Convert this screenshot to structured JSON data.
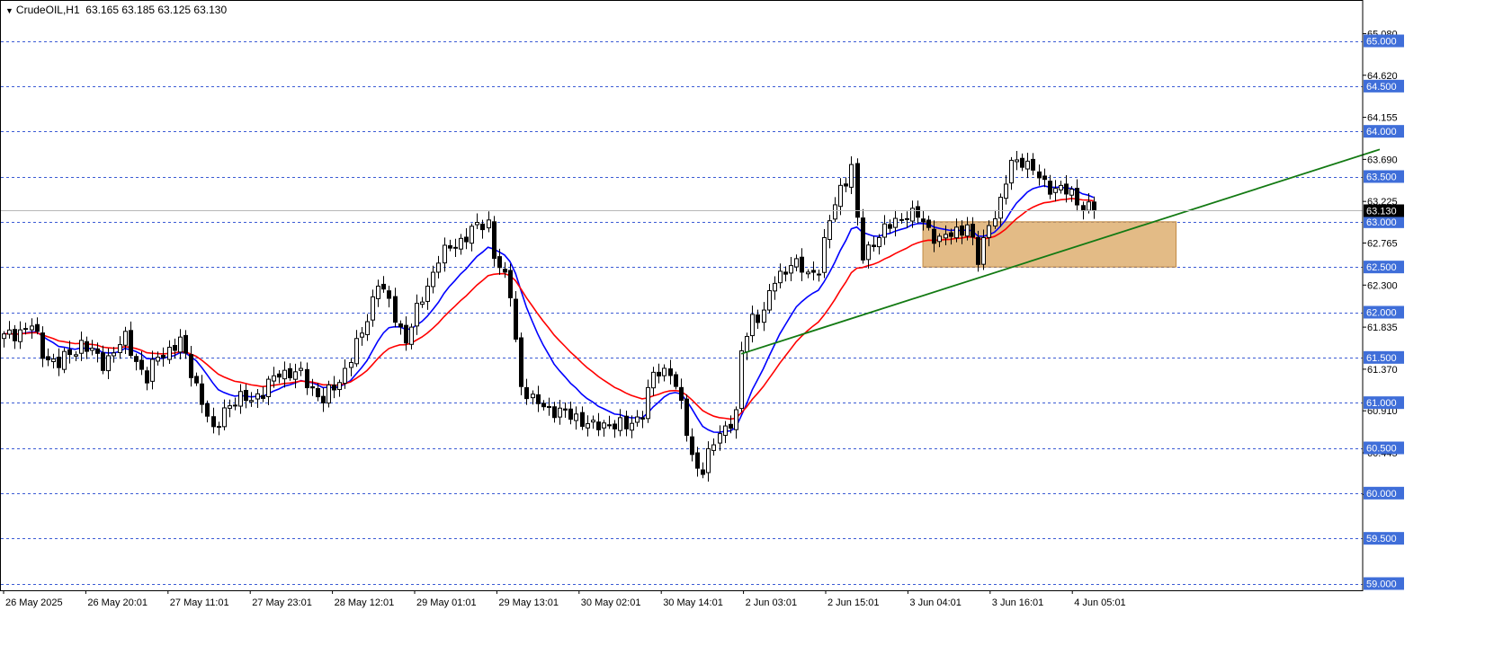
{
  "header": {
    "symbol": "CrudeOIL,H1",
    "ohlc": "63.165 63.185 63.125 63.130"
  },
  "colors": {
    "ema_fast": "#0000ff",
    "ema_slow": "#ff0000",
    "trendline": "#137a13",
    "zone": "#d9a45d",
    "level_line": "#3b5bd4",
    "level_label_bg": "#3f6ed9",
    "price_label_bg": "#000000"
  },
  "chart_data": {
    "type": "candlestick",
    "instrument": "CrudeOIL",
    "timeframe": "H1",
    "ylim": [
      58.85,
      65.5
    ],
    "current_price": 63.13,
    "axis_ticks": [
      "65.080",
      "64.620",
      "64.155",
      "63.690",
      "63.225",
      "62.765",
      "62.300",
      "61.835",
      "61.370",
      "60.910",
      "60.445",
      "59.985"
    ],
    "horizontal_levels": [
      "65.000",
      "64.500",
      "64.000",
      "63.500",
      "63.000",
      "62.500",
      "62.000",
      "61.500",
      "61.000",
      "60.500",
      "60.000",
      "59.500",
      "59.000"
    ],
    "x_labels": [
      "26 May 2025",
      "26 May 20:01",
      "27 May 11:01",
      "27 May 23:01",
      "28 May 12:01",
      "29 May 01:01",
      "29 May 13:01",
      "30 May 02:01",
      "30 May 14:01",
      "2 Jun 03:01",
      "2 Jun 15:01",
      "3 Jun 04:01",
      "3 Jun 16:01",
      "4 Jun 05:01"
    ],
    "zone": {
      "start_bar": 167,
      "end_bar": 213,
      "low": 62.5,
      "high": 63.0
    },
    "trendline": {
      "start_bar": 134,
      "start_price": 61.54,
      "end_bar": 250,
      "end_price": 63.8
    },
    "anchors": [
      [
        0,
        61.72
      ],
      [
        5,
        61.85
      ],
      [
        7,
        61.55
      ],
      [
        10,
        61.42
      ],
      [
        14,
        61.66
      ],
      [
        18,
        61.44
      ],
      [
        22,
        61.7
      ],
      [
        26,
        61.25
      ],
      [
        28,
        61.52
      ],
      [
        32,
        61.66
      ],
      [
        35,
        61.2
      ],
      [
        38,
        60.65
      ],
      [
        40,
        60.95
      ],
      [
        44,
        61.05
      ],
      [
        47,
        61.1
      ],
      [
        50,
        61.35
      ],
      [
        54,
        61.3
      ],
      [
        58,
        61.02
      ],
      [
        61,
        61.25
      ],
      [
        65,
        61.75
      ],
      [
        68,
        62.35
      ],
      [
        71,
        61.95
      ],
      [
        73,
        61.7
      ],
      [
        76,
        62.15
      ],
      [
        79,
        62.6
      ],
      [
        82,
        62.75
      ],
      [
        85,
        62.9
      ],
      [
        88,
        63.0
      ],
      [
        89,
        62.65
      ],
      [
        90,
        62.5
      ],
      [
        92,
        62.2
      ],
      [
        94,
        61.2
      ],
      [
        96,
        61.0
      ],
      [
        98,
        60.98
      ],
      [
        101,
        60.88
      ],
      [
        104,
        60.85
      ],
      [
        107,
        60.72
      ],
      [
        110,
        60.78
      ],
      [
        113,
        60.72
      ],
      [
        116,
        60.9
      ],
      [
        118,
        61.3
      ],
      [
        121,
        61.38
      ],
      [
        123,
        60.95
      ],
      [
        125,
        60.4
      ],
      [
        127,
        60.25
      ],
      [
        129,
        60.55
      ],
      [
        131,
        60.75
      ],
      [
        133,
        60.85
      ],
      [
        134,
        61.55
      ],
      [
        136,
        61.95
      ],
      [
        138,
        62.0
      ],
      [
        140,
        62.35
      ],
      [
        143,
        62.55
      ],
      [
        146,
        62.42
      ],
      [
        148,
        62.5
      ],
      [
        150,
        63.0
      ],
      [
        152,
        63.38
      ],
      [
        154,
        63.6
      ],
      [
        155,
        63.0
      ],
      [
        156,
        62.6
      ],
      [
        158,
        62.8
      ],
      [
        161,
        62.95
      ],
      [
        164,
        63.1
      ],
      [
        166,
        63.05
      ],
      [
        168,
        62.92
      ],
      [
        170,
        62.8
      ],
      [
        172,
        62.85
      ],
      [
        175,
        62.98
      ],
      [
        177,
        62.55
      ],
      [
        179,
        63.0
      ],
      [
        181,
        63.2
      ],
      [
        183,
        63.65
      ],
      [
        185,
        63.7
      ],
      [
        187,
        63.55
      ],
      [
        189,
        63.42
      ],
      [
        192,
        63.35
      ],
      [
        194,
        63.3
      ],
      [
        196,
        63.18
      ],
      [
        198,
        63.13
      ]
    ]
  },
  "price_tag": "63.130"
}
